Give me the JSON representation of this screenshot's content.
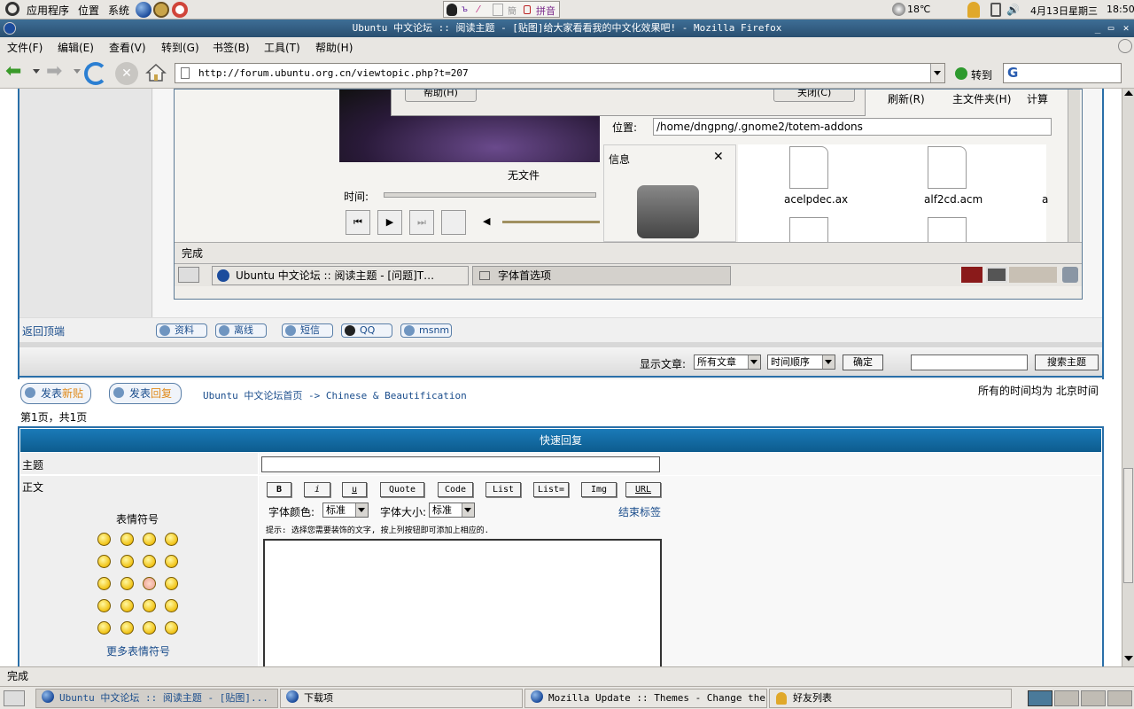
{
  "top_panel": {
    "apps": "应用程序",
    "places": "位置",
    "system": "系统",
    "input_method": "拼音",
    "weather": "18℃",
    "date": "4月13日星期三",
    "time": "18:50"
  },
  "window": {
    "title": "Ubuntu 中文论坛 :: 阅读主题 - [贴图]给大家看看我的中文化效果吧! - Mozilla Firefox"
  },
  "menubar": {
    "file": "文件(F)",
    "edit": "编辑(E)",
    "view": "查看(V)",
    "go": "转到(G)",
    "bookmarks": "书签(B)",
    "tools": "工具(T)",
    "help": "帮助(H)"
  },
  "navbar": {
    "url": "http://forum.ubuntu.org.cn/viewtopic.php?t=207",
    "go_label": "转到",
    "search_engine": "G"
  },
  "embedded_screenshot": {
    "help_button": "帮助(H)",
    "close_button": "关闭(C)",
    "refresh": "刷新(R)",
    "home_folder": "主文件夹(H)",
    "computer": "计算",
    "location_label": "位置:",
    "location_path": "/home/dngpng/.gnome2/totem-addons",
    "info_label": "信息",
    "no_file": "无文件",
    "time_label": "时间:",
    "files": [
      "acelpdec.ax",
      "alf2cd.acm",
      "a"
    ],
    "status": "完成",
    "task1": "Ubuntu 中文论坛 :: 阅读主题 - [问题]T…",
    "task2": "字体首选项"
  },
  "forum": {
    "back_to_top": "返回顶端",
    "profile_buttons": [
      "资料",
      "离线",
      "短信",
      "QQ",
      "msnm"
    ],
    "display_posts_label": "显示文章:",
    "display_posts_value": "所有文章",
    "order_value": "时间顺序",
    "confirm": "确定",
    "search_topic": "搜索主题",
    "new_topic": "发表新贴",
    "new_topic_a": "发表",
    "new_topic_b": "新贴",
    "reply_a": "发表",
    "reply_b": "回复",
    "breadcrumb": "Ubuntu 中文论坛首页 -> Chinese & Beautification",
    "timezone": "所有的时间均为 北京时间",
    "pagination": "第1页，共1页",
    "quick_reply": "快速回复",
    "subject_label": "主题",
    "body_label": "正文",
    "emoticons_label": "表情符号",
    "more_emoticons": "更多表情符号",
    "format_buttons": [
      "B",
      "i",
      "u",
      "Quote",
      "Code",
      "List",
      "List=",
      "Img",
      "URL"
    ],
    "font_color_label": "字体颜色:",
    "font_color_value": "标准",
    "font_size_label": "字体大小:",
    "font_size_value": "标准",
    "close_tags": "结束标签",
    "hint": "提示: 选择您需要装饰的文字, 按上列按钮即可添加上相应的."
  },
  "statusbar": {
    "text": "完成"
  },
  "taskbar": {
    "items": [
      "Ubuntu 中文论坛 :: 阅读主题 - [贴图]...",
      "下载项",
      "Mozilla Update :: Themes - Change the ...",
      "好友列表"
    ]
  },
  "colors": {
    "titlebar": "#2f5a80",
    "forum_header": "#0d5c8e",
    "link": "#1a4d8c"
  }
}
